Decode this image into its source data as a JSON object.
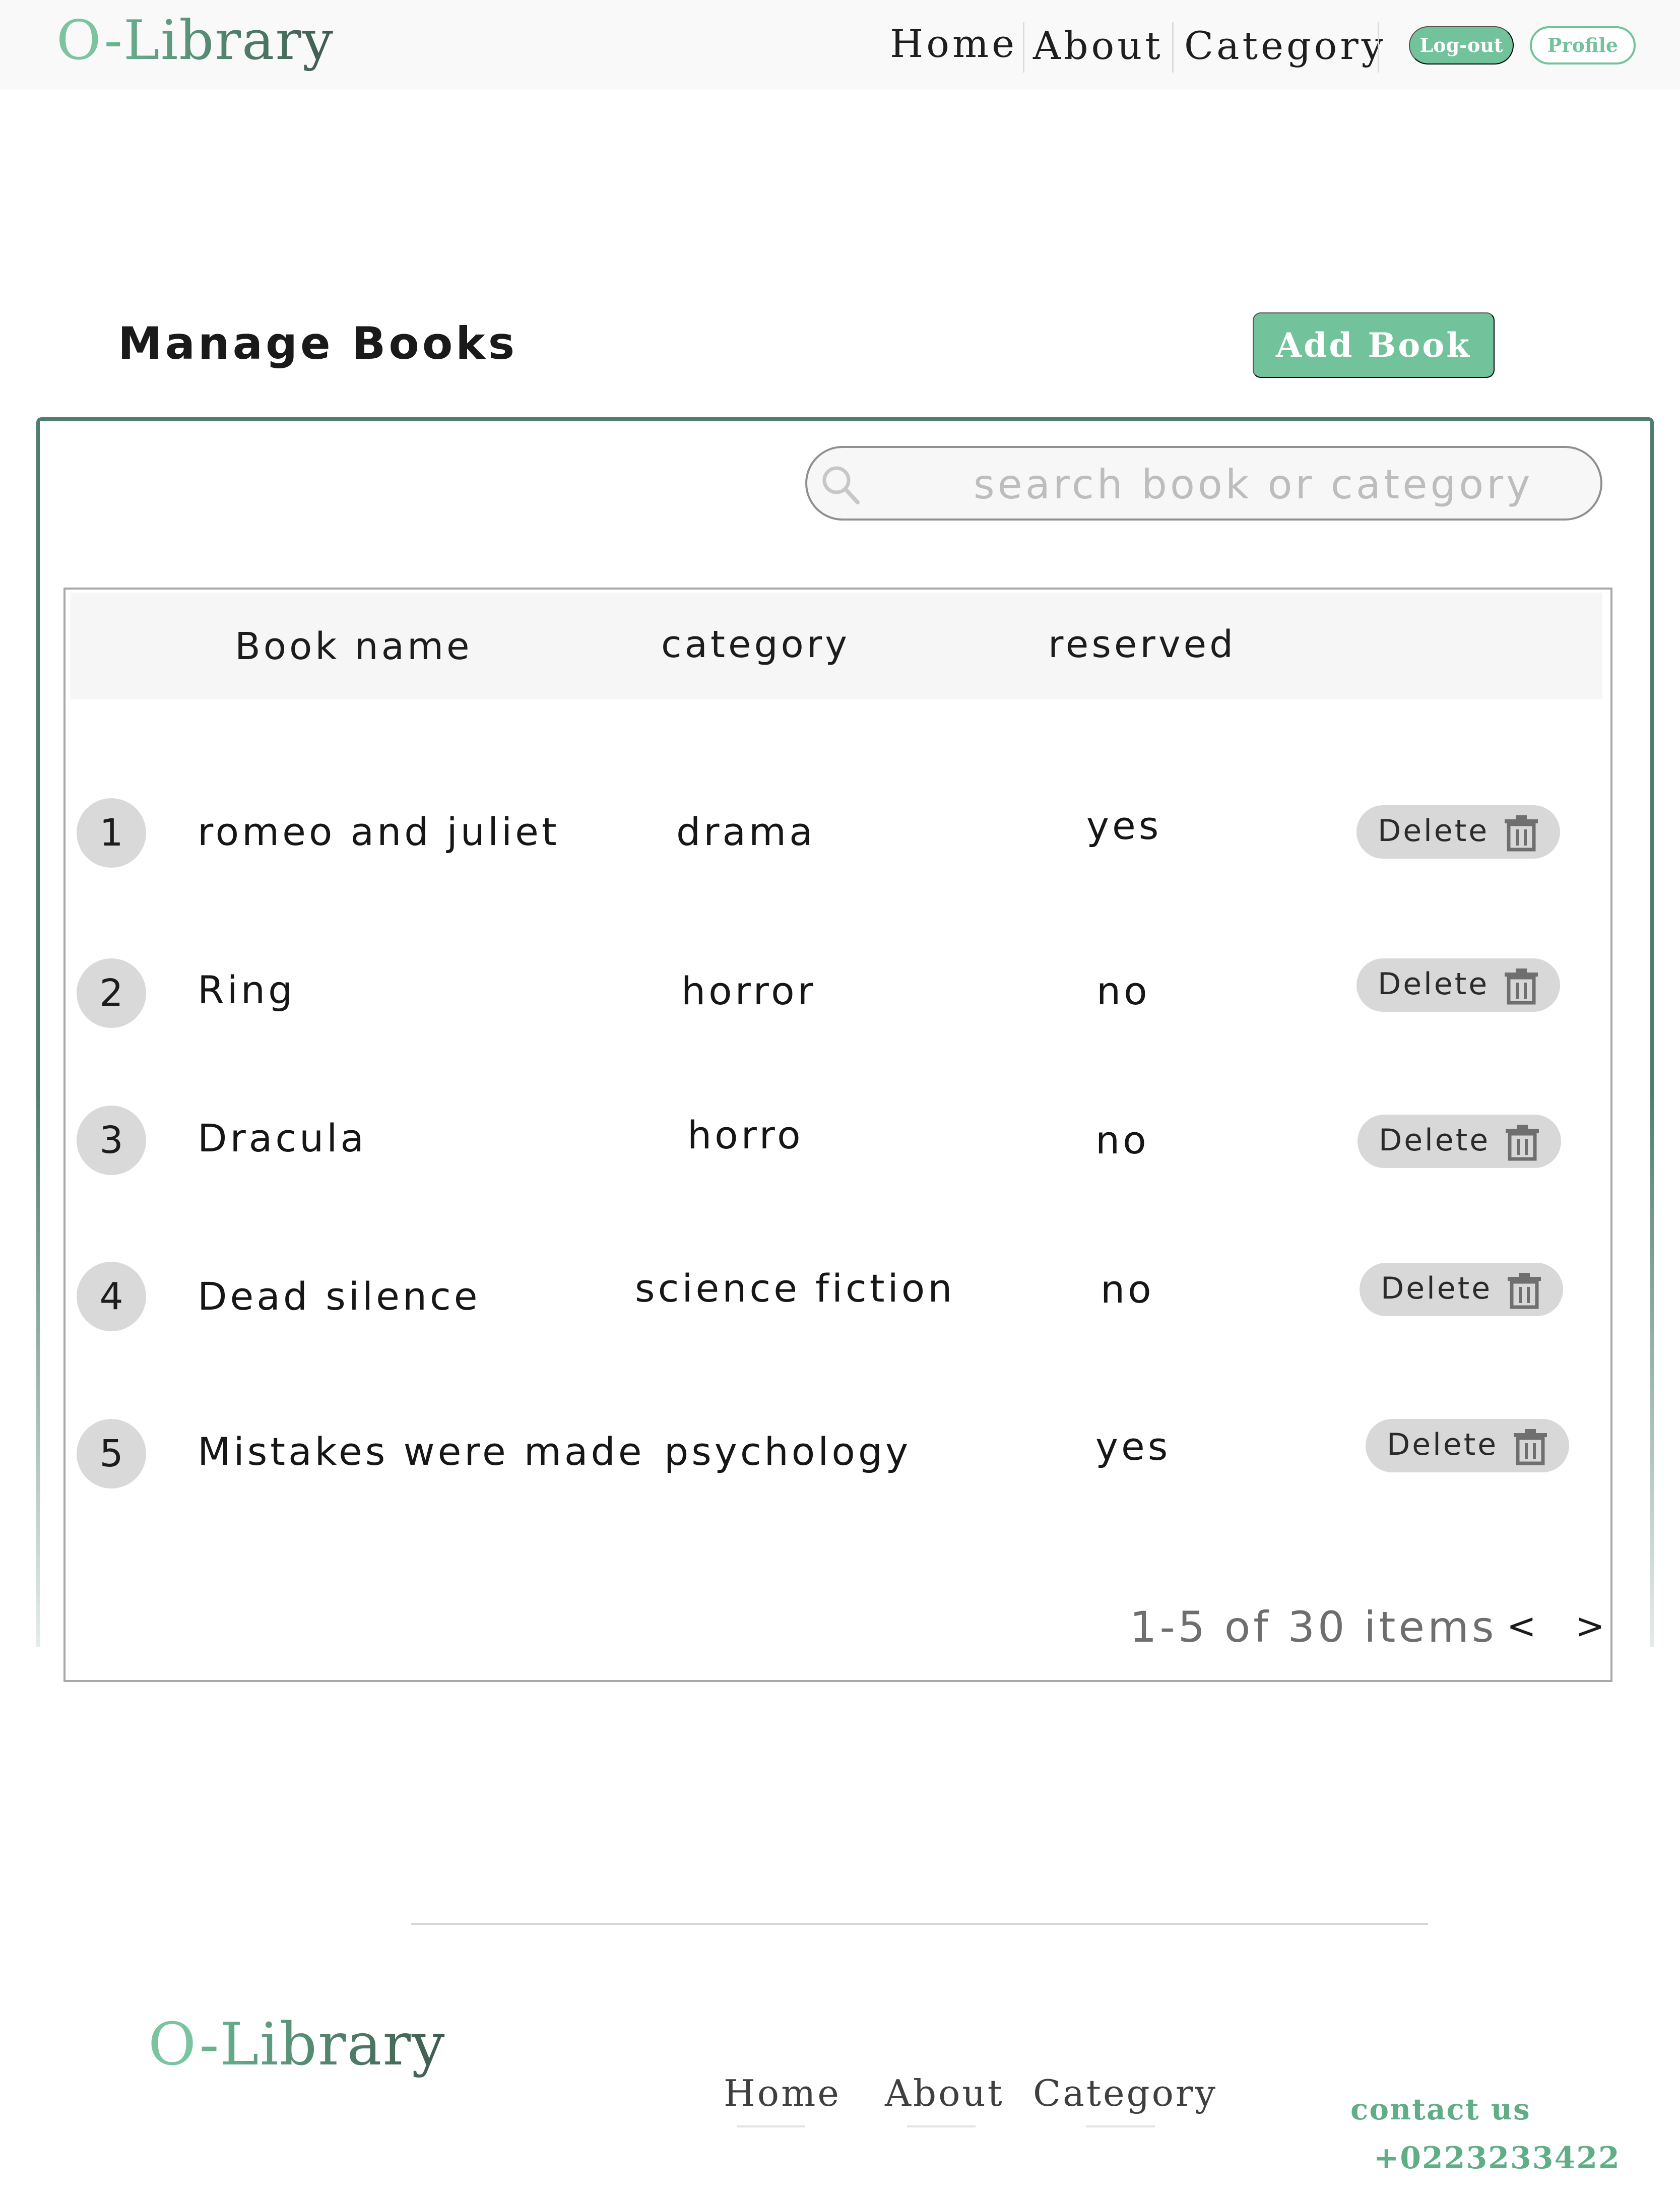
{
  "header": {
    "logo_first": "O",
    "logo_rest": "-Library",
    "nav": [
      "Home",
      "About",
      "Category"
    ],
    "logout_label": "Log-out",
    "profile_label": "Profile"
  },
  "main": {
    "title": "Manage Books",
    "add_button_label": "Add Book",
    "search": {
      "placeholder": "search book or category",
      "value": ""
    },
    "columns": [
      "Book name",
      "category",
      "reserved"
    ],
    "rows": [
      {
        "index": "1",
        "name": "romeo and juliet",
        "category": "drama",
        "reserved": "yes",
        "action": "Delete"
      },
      {
        "index": "2",
        "name": "Ring",
        "category": "horror",
        "reserved": "no",
        "action": "Delete"
      },
      {
        "index": "3",
        "name": "Dracula",
        "category": "horro",
        "reserved": "no",
        "action": "Delete"
      },
      {
        "index": "4",
        "name": "Dead silence",
        "category": "science fiction",
        "reserved": "no",
        "action": "Delete"
      },
      {
        "index": "5",
        "name": "Mistakes were made",
        "category": "psychology",
        "reserved": "yes",
        "action": "Delete"
      }
    ],
    "pagination": {
      "summary": "1-5 of 30 items",
      "prev": "<",
      "next": ">"
    }
  },
  "footer": {
    "logo_first": "O",
    "logo_rest": "-Library",
    "nav": [
      "Home",
      "About",
      "Category"
    ],
    "contact_label": "contact us",
    "phone": "+0223233422"
  },
  "colors": {
    "accent": "#72c29b",
    "panel_border": "#4f7f6c",
    "header_bg": "#f9f9f9",
    "pill_bg": "#d8d8d8"
  },
  "icons": {
    "search": "magnifier-icon",
    "delete": "trash-icon"
  }
}
